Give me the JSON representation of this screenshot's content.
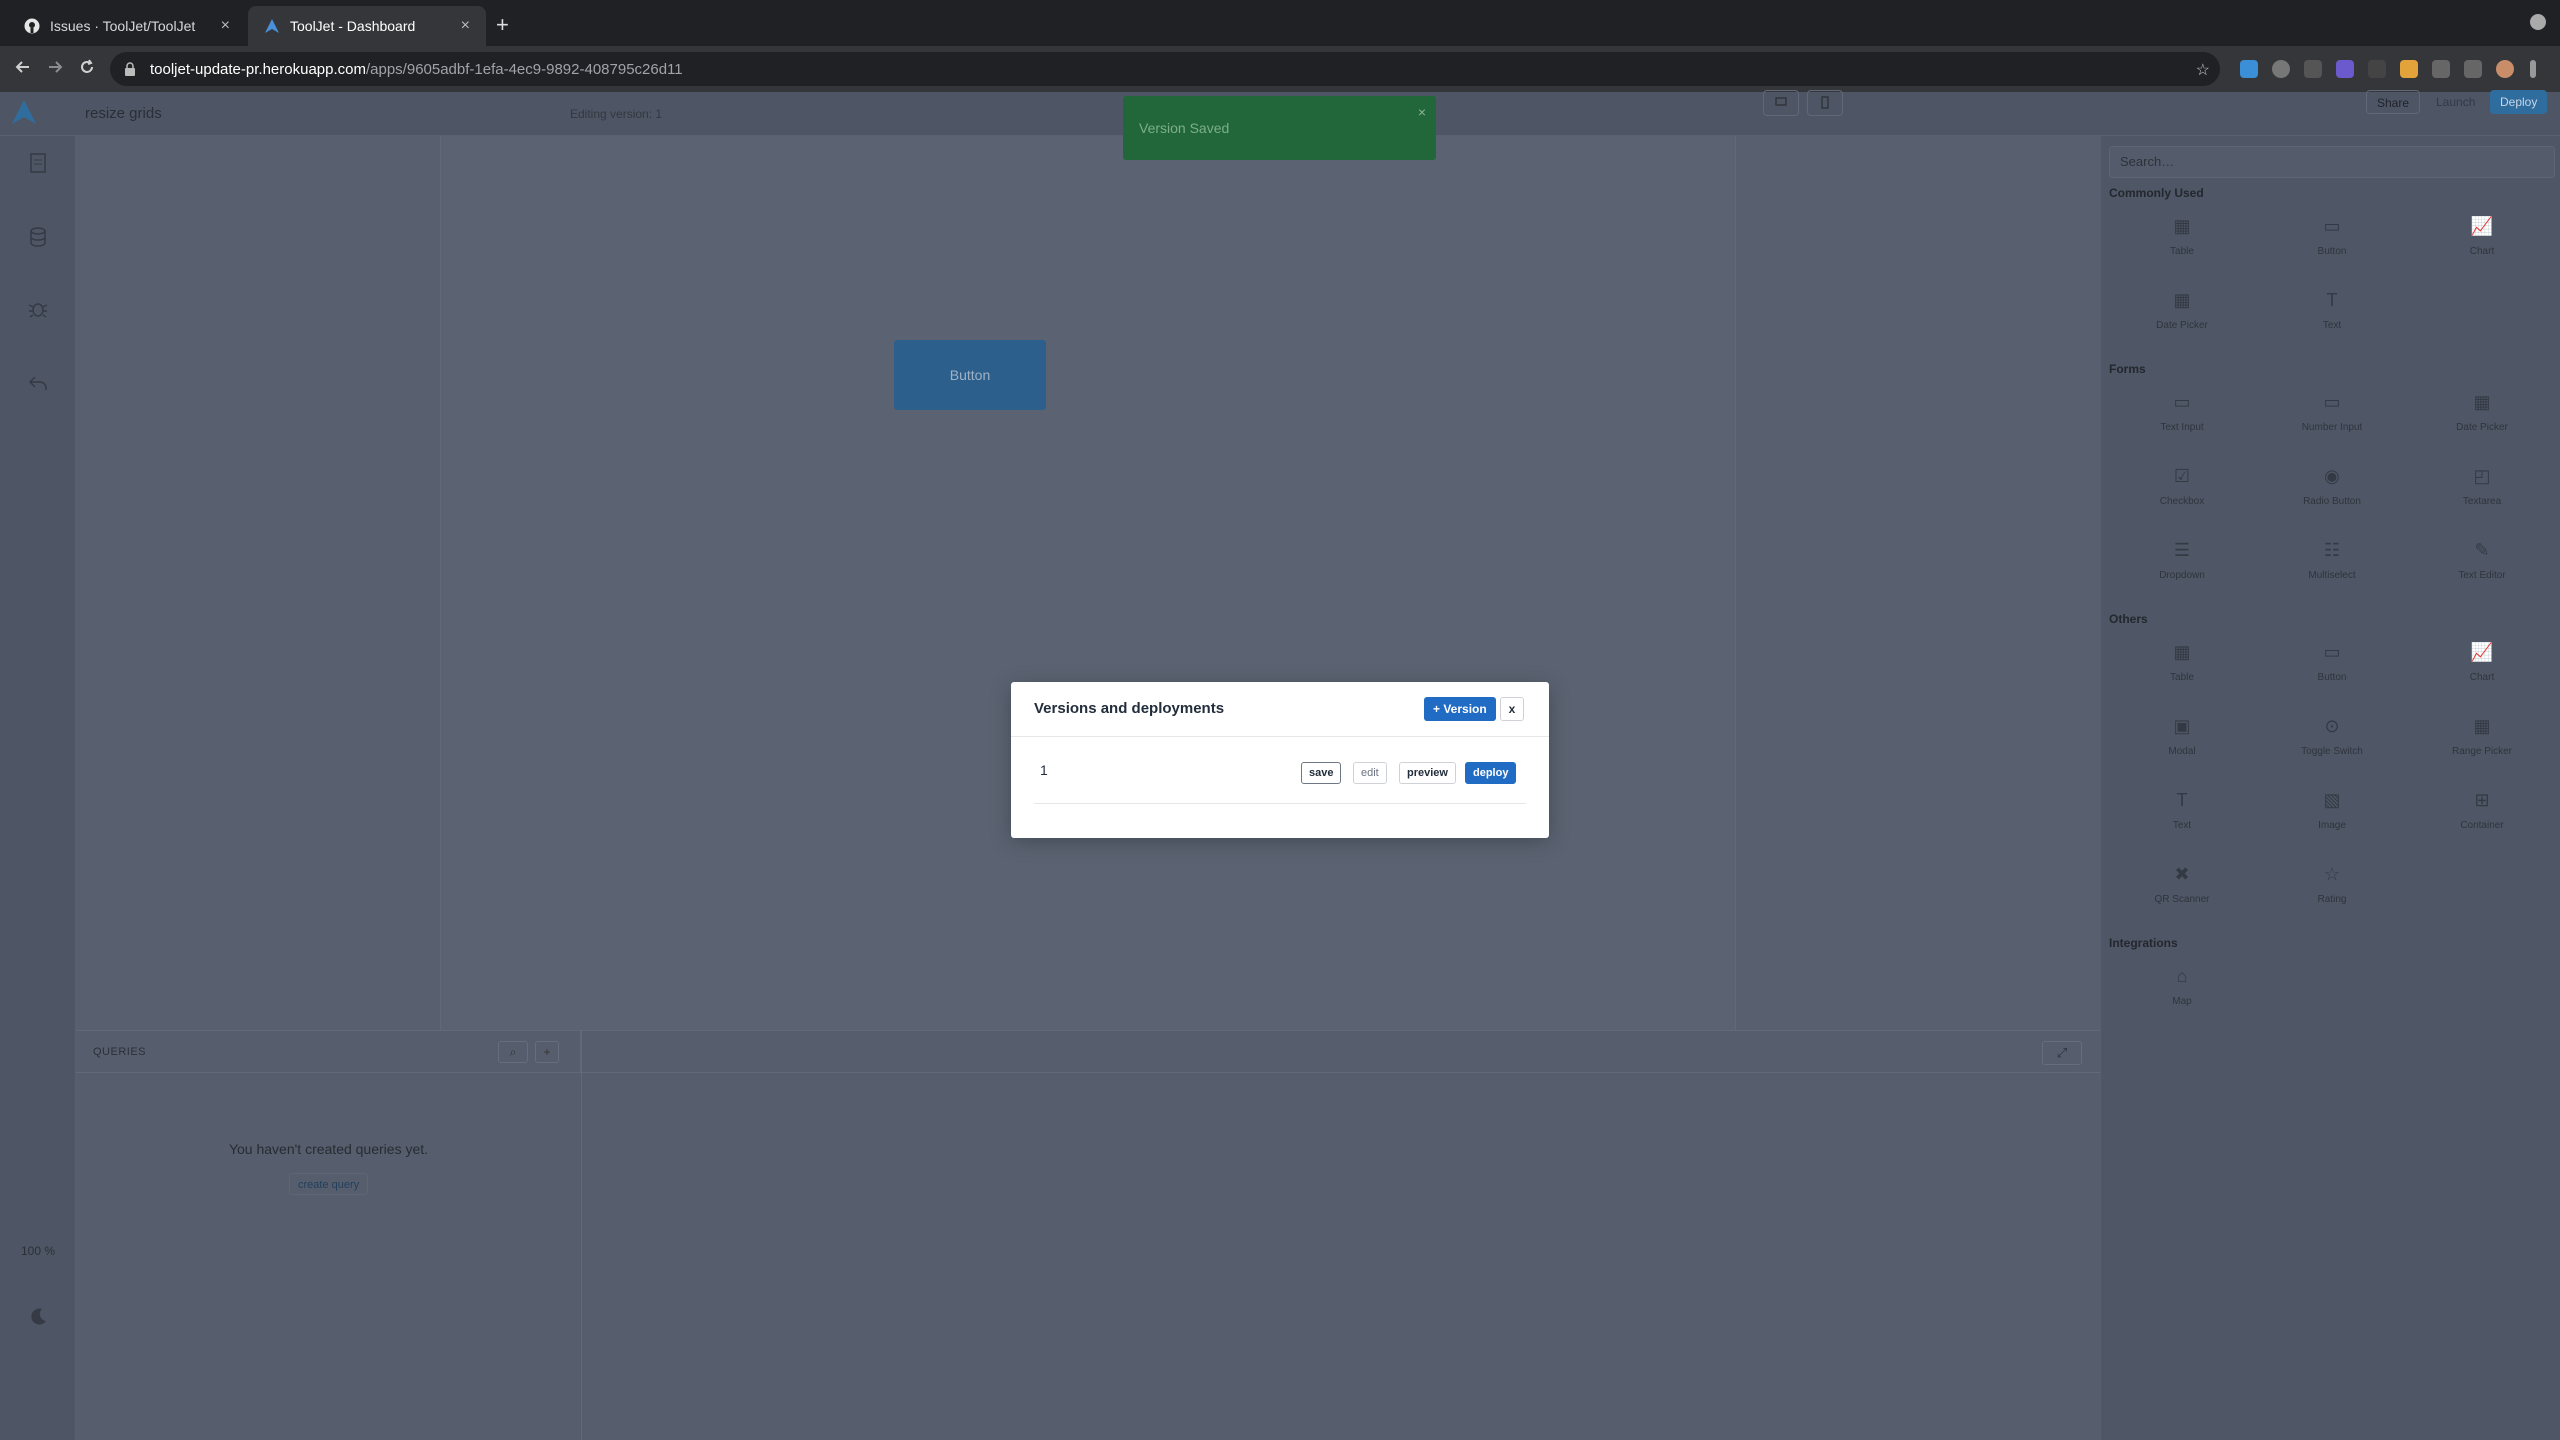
{
  "browser": {
    "tabs": [
      {
        "label": "Issues · ToolJet/ToolJet",
        "active": false
      },
      {
        "label": "ToolJet - Dashboard",
        "active": true
      }
    ],
    "close_glyph": "×",
    "new_tab_glyph": "+",
    "url_host": "tooljet-update-pr.herokuapp.com",
    "url_path": "/apps/9605adbf-1efa-4ec9-9892-408795c26d11"
  },
  "header": {
    "app_name": "resize grids",
    "editing_version": "Editing version: 1",
    "share_label": "Share",
    "launch_label": "Launch",
    "deploy_label": "Deploy"
  },
  "toast": {
    "message": "Version Saved",
    "close_glyph": "×",
    "color": "#22673a"
  },
  "canvas": {
    "button_label": "Button"
  },
  "left_sidebar": {
    "zoom": "100 %"
  },
  "queries": {
    "title": "QUERIES",
    "search_glyph": "⌕",
    "add_glyph": "+",
    "empty_text": "You haven't created queries yet.",
    "create_label": "create query",
    "expand_glyph": "⤢"
  },
  "right_sidebar": {
    "search_placeholder": "Search…",
    "sections": [
      {
        "title": "Commonly Used",
        "items": [
          "Table",
          "Button",
          "Chart",
          "Date Picker",
          "Text"
        ]
      },
      {
        "title": "Forms",
        "items": [
          "Text Input",
          "Number Input",
          "Date Picker",
          "Checkbox",
          "Radio Button",
          "Textarea",
          "Dropdown",
          "Multiselect",
          "Text Editor"
        ]
      },
      {
        "title": "Others",
        "items": [
          "Table",
          "Button",
          "Chart",
          "Modal",
          "Toggle Switch",
          "Range Picker",
          "Text",
          "Image",
          "Container",
          "QR Scanner",
          "Rating"
        ]
      },
      {
        "title": "Integrations",
        "items": [
          "Map"
        ]
      }
    ]
  },
  "modal": {
    "title": "Versions and deployments",
    "add_version_label": "+ Version",
    "close_label": "x",
    "versions": [
      {
        "name": "1",
        "save": "save",
        "edit": "edit",
        "preview": "preview",
        "deploy": "deploy"
      }
    ]
  },
  "colors": {
    "accent": "#206bc4",
    "toast_green": "#22673a"
  }
}
